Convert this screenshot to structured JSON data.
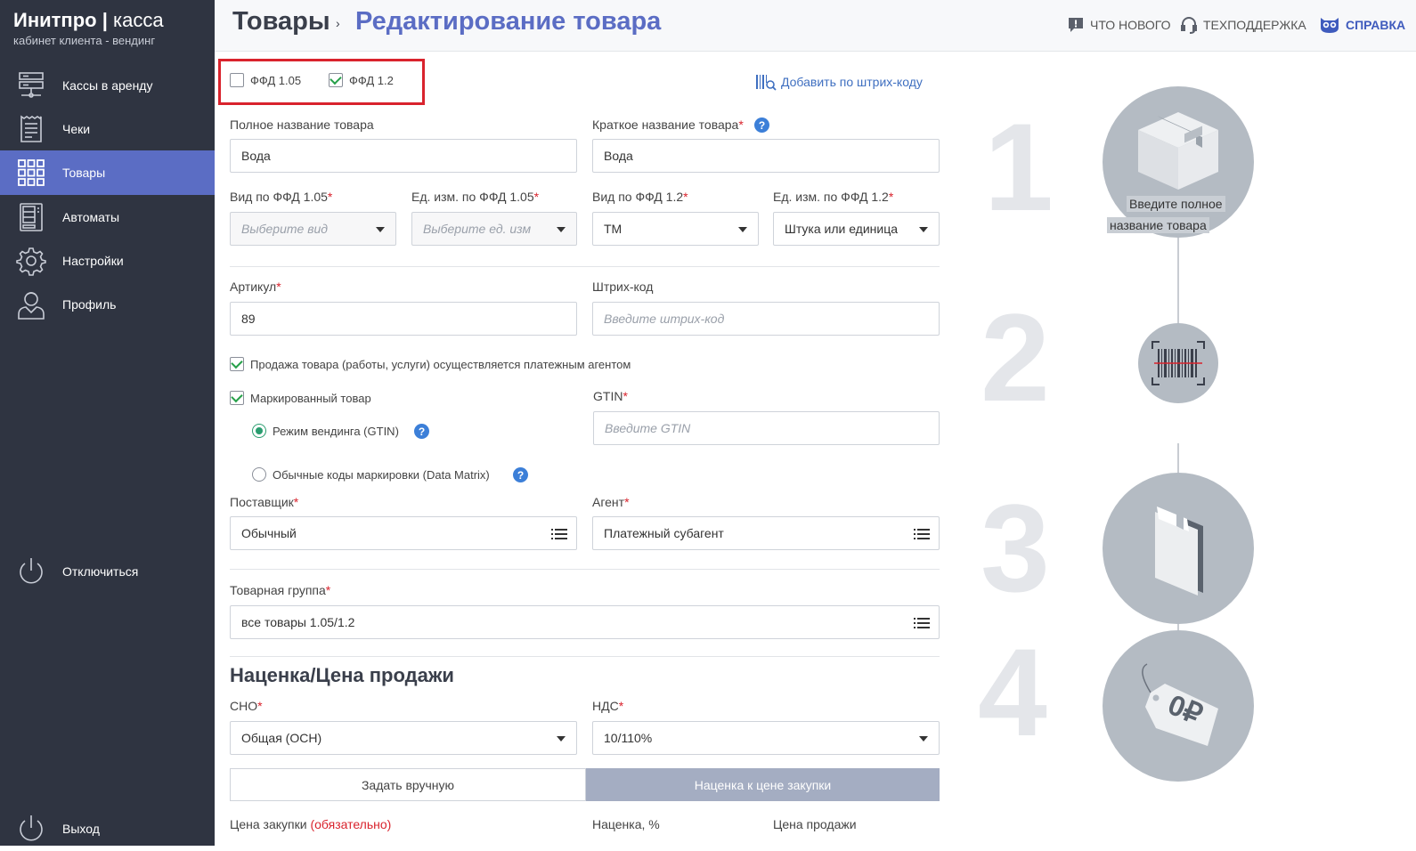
{
  "brand": {
    "title_bold": "Инитпро",
    "title_sep": "|",
    "title_light": "касса",
    "subtitle": "кабинет клиента - вендинг"
  },
  "sidebar": {
    "items": [
      {
        "label": "Кассы в аренду",
        "icon": "server-icon"
      },
      {
        "label": "Чеки",
        "icon": "receipt-icon"
      },
      {
        "label": "Товары",
        "icon": "grid-icon",
        "active": true
      },
      {
        "label": "Автоматы",
        "icon": "vending-machine-icon"
      },
      {
        "label": "Настройки",
        "icon": "gear-icon"
      },
      {
        "label": "Профиль",
        "icon": "user-icon"
      }
    ],
    "disconnect": "Отключиться",
    "logout": "Выход"
  },
  "header": {
    "breadcrumb_root": "Товары",
    "breadcrumb_sep": "›",
    "breadcrumb_current": "Редактирование товара",
    "links": {
      "whats_new": "ЧТО НОВОГО",
      "support": "ТЕХПОДДЕРЖКА",
      "help": "СПРАВКА"
    }
  },
  "form": {
    "ffd105": {
      "label": "ФФД 1.05",
      "checked": false
    },
    "ffd12": {
      "label": "ФФД 1.2",
      "checked": true
    },
    "add_by_barcode": "Добавить по штрих-коду",
    "full_name": {
      "label": "Полное название товара",
      "value": "Вода"
    },
    "short_name": {
      "label": "Краткое название товара",
      "value": "Вода"
    },
    "kind105": {
      "label": "Вид по ФФД 1.05",
      "placeholder": "Выберите вид"
    },
    "unit105": {
      "label": "Ед. изм. по ФФД 1.05",
      "placeholder": "Выберите ед. изм"
    },
    "kind12": {
      "label": "Вид по ФФД 1.2",
      "value": "ТМ"
    },
    "unit12": {
      "label": "Ед. изм. по ФФД 1.2",
      "value": "Штука или единица"
    },
    "article": {
      "label": "Артикул",
      "value": "89"
    },
    "barcode": {
      "label": "Штрих-код",
      "placeholder": "Введите штрих-код"
    },
    "agent_sale": {
      "label": "Продажа товара (работы, услуги) осуществляется платежным агентом",
      "checked": true
    },
    "marked": {
      "label": "Маркированный товар",
      "checked": true
    },
    "mode_vending": {
      "label": "Режим вендинга (GTIN)",
      "selected": true
    },
    "mode_datamatrix": {
      "label": "Обычные коды маркировки (Data Matrix)",
      "selected": false
    },
    "gtin": {
      "label": "GTIN",
      "placeholder": "Введите GTIN"
    },
    "supplier": {
      "label": "Поставщик",
      "value": "Обычный"
    },
    "agent": {
      "label": "Агент",
      "value": "Платежный субагент"
    },
    "group": {
      "label": "Товарная группа",
      "value": "все товары 1.05/1.2"
    },
    "pricing_title": "Наценка/Цена продажи",
    "sno": {
      "label": "СНО",
      "value": "Общая (ОСН)"
    },
    "nds": {
      "label": "НДС",
      "value": "10/110%"
    },
    "tab_manual": "Задать вручную",
    "tab_markup": "Наценка к цене закупки",
    "purchase_price_label": "Цена закупки",
    "purchase_price_req": "(обязательно)",
    "markup_label": "Наценка, %",
    "sale_price_label": "Цена продажи"
  },
  "steps": {
    "numbers": [
      "1",
      "2",
      "3",
      "4"
    ],
    "caption_line1": "Введите полное",
    "caption_line2": "название товара",
    "price_tag": "0₽"
  },
  "colors": {
    "sidebar_bg": "#2f3441",
    "accent": "#5b6dc4",
    "required": "#d9232d",
    "highlight_box": "#d9232d",
    "active_tab": "#a4adc2"
  }
}
